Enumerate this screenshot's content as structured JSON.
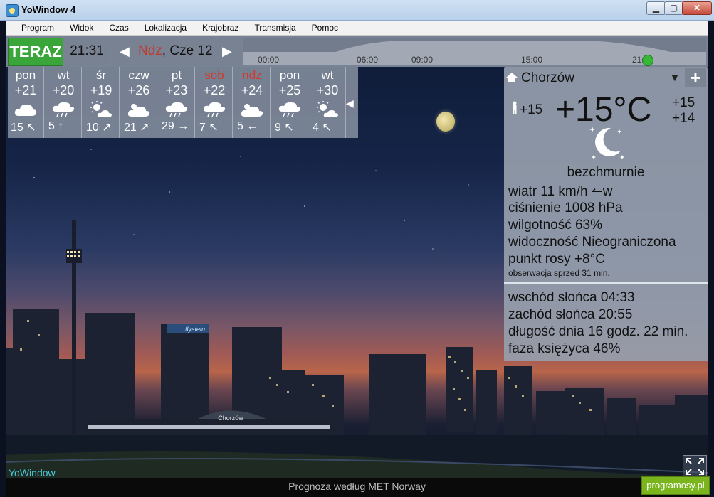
{
  "window": {
    "title": "YoWindow 4"
  },
  "menu": [
    "Program",
    "Widok",
    "Czas",
    "Lokalizacja",
    "Krajobraz",
    "Transmisja",
    "Pomoc"
  ],
  "topbar": {
    "now_label": "TERAZ",
    "time": "21:31",
    "date_day": "Ndz",
    "date_rest": ", Cze 12",
    "timeline_labels": [
      "00:00",
      "06:00",
      "09:00",
      "15:00",
      "21:"
    ]
  },
  "forecast": [
    {
      "day": "pon",
      "temp": "+21",
      "icon": "cloud-icon",
      "wind": "15 ↖",
      "weekend": false
    },
    {
      "day": "wt",
      "temp": "+20",
      "icon": "rain-icon",
      "wind": "5 ↑",
      "weekend": false
    },
    {
      "day": "śr",
      "temp": "+19",
      "icon": "sun-cloud-icon",
      "wind": "10 ↗",
      "weekend": false
    },
    {
      "day": "czw",
      "temp": "+26",
      "icon": "cloud-sun-icon",
      "wind": "21 ↗",
      "weekend": false
    },
    {
      "day": "pt",
      "temp": "+23",
      "icon": "rain-icon",
      "wind": "29 →",
      "weekend": false
    },
    {
      "day": "sob",
      "temp": "+22",
      "icon": "rain-icon",
      "wind": "7 ↖",
      "weekend": true
    },
    {
      "day": "ndz",
      "temp": "+24",
      "icon": "cloud-sun-icon",
      "wind": "5 ←",
      "weekend": true
    },
    {
      "day": "pon",
      "temp": "+25",
      "icon": "rain-icon",
      "wind": "9 ↖",
      "weekend": false
    },
    {
      "day": "wt",
      "temp": "+30",
      "icon": "sun-cloud-icon",
      "wind": "4 ↖",
      "weekend": false
    }
  ],
  "current": {
    "location": "Chorzów",
    "feels_like": "+15",
    "temperature": "+15°C",
    "high": "+15",
    "low": "+14",
    "condition": "bezchmurnie",
    "wind": "wiatr  11 km/h ↼w",
    "pressure": "ciśnienie  1008 hPa",
    "humidity": "wilgotność  63%",
    "visibility": "widoczność  Nieograniczona",
    "dew_point": "punkt rosy  +8°C",
    "observation": "obserwacja sprzed 31 min."
  },
  "astro": {
    "sunrise": "wschód słońca  04:33",
    "sunset": "zachód słońca  20:55",
    "day_length": "długość dnia  16 godz. 22 min.",
    "moon_phase": "faza księżyca  46%"
  },
  "scene": {
    "station_name": "Chorzów",
    "billboard": "flystein"
  },
  "bottom": {
    "brand": "YoWindow",
    "status": "Prognoza według MET Norway",
    "badge": "programosy.pl"
  }
}
